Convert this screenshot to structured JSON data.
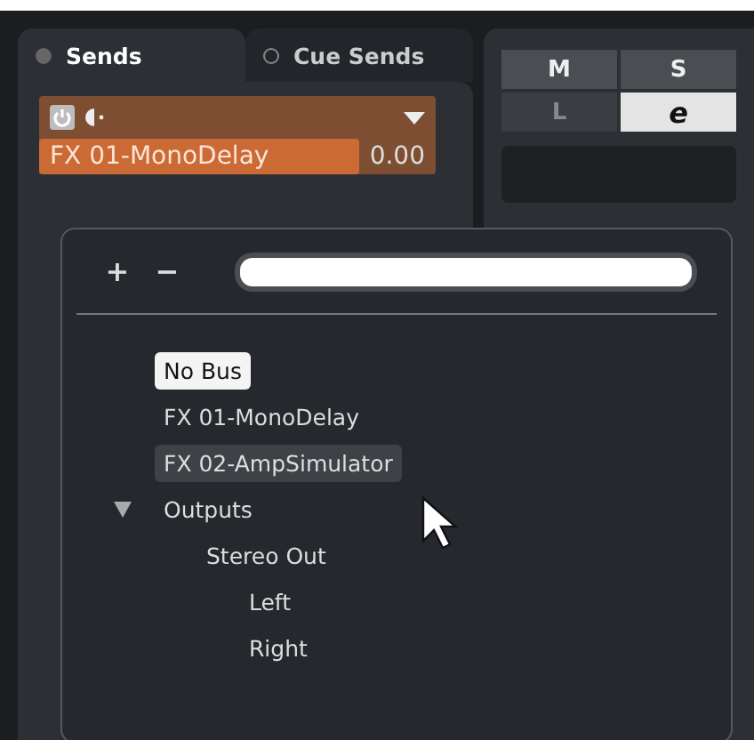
{
  "tabs": [
    {
      "label": "Sends",
      "selected": true
    },
    {
      "label": "Cue Sends",
      "selected": false
    }
  ],
  "send": {
    "on": true,
    "destination": "FX 01-MonoDelay",
    "value": "0.00"
  },
  "channel_buttons": [
    {
      "label": "M",
      "selected": false,
      "disabled": false
    },
    {
      "label": "S",
      "selected": false,
      "disabled": false
    },
    {
      "label": "L",
      "selected": false,
      "disabled": true
    },
    {
      "label": "e",
      "selected": true,
      "disabled": false
    }
  ],
  "popup": {
    "add_label": "+",
    "remove_label": "−",
    "tree": [
      {
        "label": "No Bus",
        "selected": true,
        "hovered": false
      },
      {
        "label": "FX 01-MonoDelay",
        "selected": false,
        "hovered": false
      },
      {
        "label": "FX 02-AmpSimulator",
        "selected": false,
        "hovered": true
      },
      {
        "label": "Outputs",
        "selected": false,
        "hovered": false,
        "expanded": true,
        "children": [
          {
            "label": "Stereo Out",
            "selected": false,
            "hovered": false,
            "children": [
              {
                "label": "Left",
                "selected": false,
                "hovered": false
              },
              {
                "label": "Right",
                "selected": false,
                "hovered": false
              }
            ]
          }
        ]
      }
    ]
  }
}
